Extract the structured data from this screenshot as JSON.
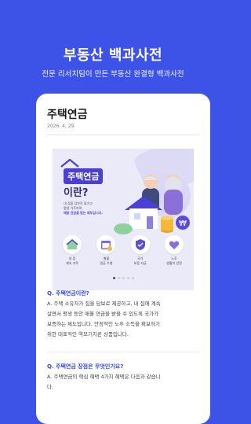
{
  "header": {
    "title": "부동산 백과사전",
    "subtitle": "전문 리서치팀이 만든 부동산 완결형 백과사전"
  },
  "card": {
    "title": "주택연금",
    "date": "2026. 4. 29.",
    "banner": {
      "title_line1": "주택연금",
      "title_line2": "이란?",
      "desc_lines": [
        "내 집을 담보로 맡기고",
        "평생 거주하며",
        "매달 연금을 받는 제도입니다."
      ],
      "icons": [
        {
          "icon": "house-icon",
          "label": "내 집\n계속 거주"
        },
        {
          "icon": "calendar-icon",
          "label": "매월\n연금 수령"
        },
        {
          "icon": "shield-icon",
          "label": "국가\n보증 지급"
        },
        {
          "icon": "heart-icon",
          "label": "노후\n생활의 안정"
        }
      ],
      "currency_symbol": "₩",
      "slide_count": 5,
      "active_slide": 1
    },
    "qa": [
      {
        "question": "Q. 주택연금이란?",
        "answer_lines": [
          "A. 주택 소유자가 집을 담보로 제공하고, 내 집에 계속",
          "살면서 평생 동안 매월 연금을 받을 수 있도록 국가가",
          "보증하는 제도입니다. 안정적인 노후 소득을 확보하기",
          "위한 대표적인 역모기지론 상품입니다."
        ]
      },
      {
        "question": "Q. 주택연금 장점은 무엇인가요?",
        "answer_lines": [
          "A. 주택연금의 핵심 혜택 4가지 혜택은 다음과 같습니",
          "다."
        ]
      }
    ]
  },
  "colors": {
    "background": "#3d52e6",
    "accent": "#2f47e0",
    "banner_purple": "#4b3fd6"
  }
}
